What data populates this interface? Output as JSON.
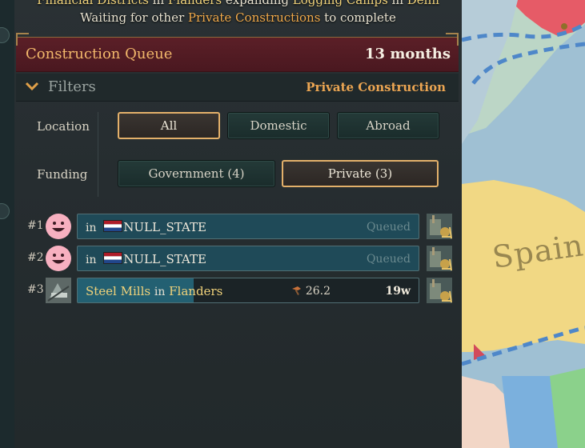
{
  "notice": {
    "line1": {
      "a": "Financial Districts",
      "b": " in ",
      "c": "Flanders",
      "d": " expanding ",
      "e": "Logging Camps",
      "f": " in ",
      "g": "Delhi"
    },
    "line2": {
      "a": "Waiting for other ",
      "b": "Private Constructions",
      "c": " to complete"
    }
  },
  "queue": {
    "title": "Construction Queue",
    "duration": "13 months"
  },
  "filters": {
    "label": "Filters",
    "type": "Private Construction",
    "location_label": "Location",
    "funding_label": "Funding",
    "location_options": [
      "All",
      "Domestic",
      "Abroad"
    ],
    "location_selected": "All",
    "funding_options": [
      "Government (4)",
      "Private (3)"
    ],
    "funding_selected": "Private (3)"
  },
  "items": [
    {
      "rank": "#1",
      "prefix": "in",
      "state": "NULL_STATE",
      "status": "Queued"
    },
    {
      "rank": "#2",
      "prefix": "in",
      "state": "NULL_STATE",
      "status": "Queued"
    },
    {
      "rank": "#3",
      "building": "Steel Mills",
      "prefix": "in",
      "state": "Flanders",
      "speed": "26.2",
      "weeks": "19w",
      "progress": 0.34
    }
  ],
  "map": {
    "label": "Spain"
  },
  "colors": {
    "accent": "#f0a94a",
    "header_bg": "#5b1f27",
    "bar_blue": "#1f4a58"
  }
}
